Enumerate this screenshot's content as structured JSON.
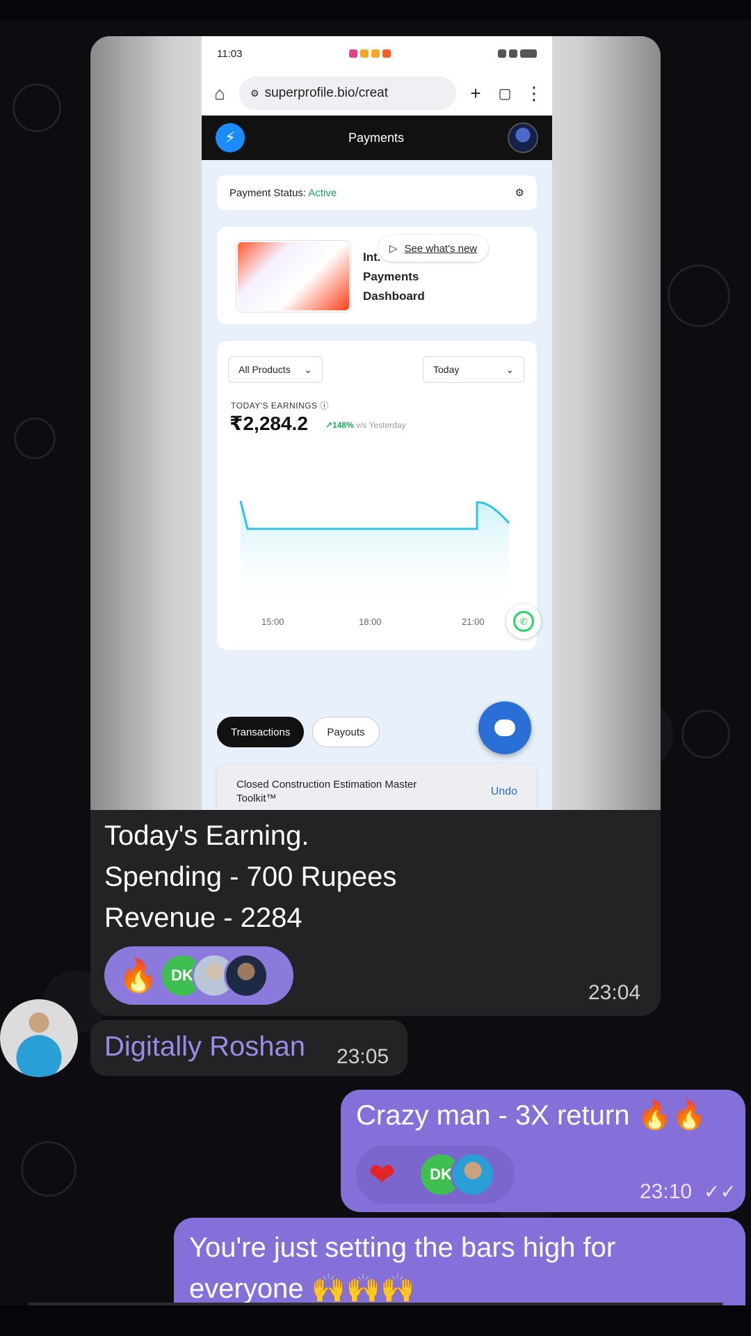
{
  "phone": {
    "status_time": "11:03",
    "url": "superprofile.bio/creat",
    "app_title": "Payments",
    "payment_status_label": "Payment Status:",
    "payment_status_value": "Active",
    "promo_text_line1": "Int.",
    "promo_text_line2": "Payments",
    "promo_text_line3": "Dashboard",
    "see_new_label": "See what's new",
    "products_dropdown": "All Products",
    "period_dropdown": "Today",
    "earnings_label": "TODAY'S EARNINGS",
    "earnings_value": "₹2,284.2",
    "earnings_change_pct": "↗148%",
    "earnings_change_text": "v/s Yesterday",
    "chart_xticks": [
      "15:00",
      "18:00",
      "21:00"
    ],
    "tab_transactions": "Transactions",
    "tab_payouts": "Payouts",
    "toast_text": "Closed Construction Estimation Master Toolkit™",
    "toast_undo": "Undo"
  },
  "message_media": {
    "caption_line1": "Today's Earning.",
    "caption_line2": "Spending - 700 Rupees",
    "caption_line3": "Revenue - 2284",
    "reaction_emoji": "🔥",
    "reaction_user_initials": "DK",
    "time": "23:04"
  },
  "message_name": {
    "sender_name": "Digitally Roshan",
    "time": "23:05"
  },
  "message_out1": {
    "text": "Crazy man - 3X return 🔥🔥",
    "reaction_emoji": "❤",
    "reaction_user_initials": "DK",
    "time": "23:10",
    "read_icon": "double-check-icon"
  },
  "message_out2": {
    "text_line1": "You're just setting the bars high for",
    "text_line2": "everyone 🙌🙌🙌"
  },
  "colors": {
    "bubble_in": "#232325",
    "bubble_out": "#8470d8",
    "sender_name": "#9a8ce6",
    "accent_green": "#1aa45e"
  }
}
